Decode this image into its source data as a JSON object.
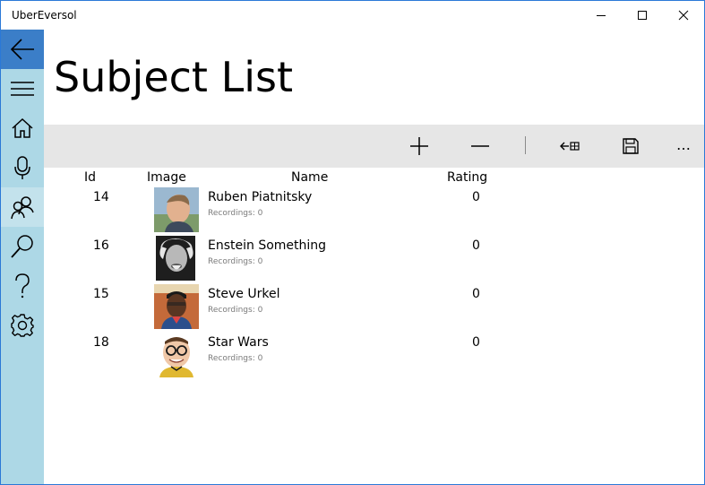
{
  "window": {
    "title": "UberEversol"
  },
  "sidebar": {
    "items": [
      {
        "icon": "back-arrow-icon"
      },
      {
        "icon": "hamburger-menu-icon"
      },
      {
        "icon": "home-icon"
      },
      {
        "icon": "microphone-icon"
      },
      {
        "icon": "people-icon"
      },
      {
        "icon": "search-icon"
      },
      {
        "icon": "help-icon"
      },
      {
        "icon": "gear-icon"
      }
    ],
    "active_index": 4,
    "colors": {
      "background": "#add8e6",
      "back_button": "#3b7ec8",
      "active": "#c3e2ec"
    }
  },
  "page": {
    "title": "Subject List"
  },
  "command_bar": {
    "buttons": [
      "add-icon",
      "remove-icon",
      "back-to-grid-icon",
      "save-icon",
      "more-icon"
    ],
    "more_label": "…"
  },
  "table": {
    "headers": {
      "id": "Id",
      "image": "Image",
      "name": "Name",
      "rating": "Rating"
    },
    "recordings_label": "Recordings:",
    "rows": [
      {
        "id": "14",
        "name": "Ruben Piatnitsky",
        "recordings": "0",
        "rating": "0"
      },
      {
        "id": "16",
        "name": "Enstein Something",
        "recordings": "0",
        "rating": "0"
      },
      {
        "id": "15",
        "name": "Steve Urkel",
        "recordings": "0",
        "rating": "0"
      },
      {
        "id": "18",
        "name": "Star Wars",
        "recordings": "0",
        "rating": "0"
      }
    ]
  }
}
